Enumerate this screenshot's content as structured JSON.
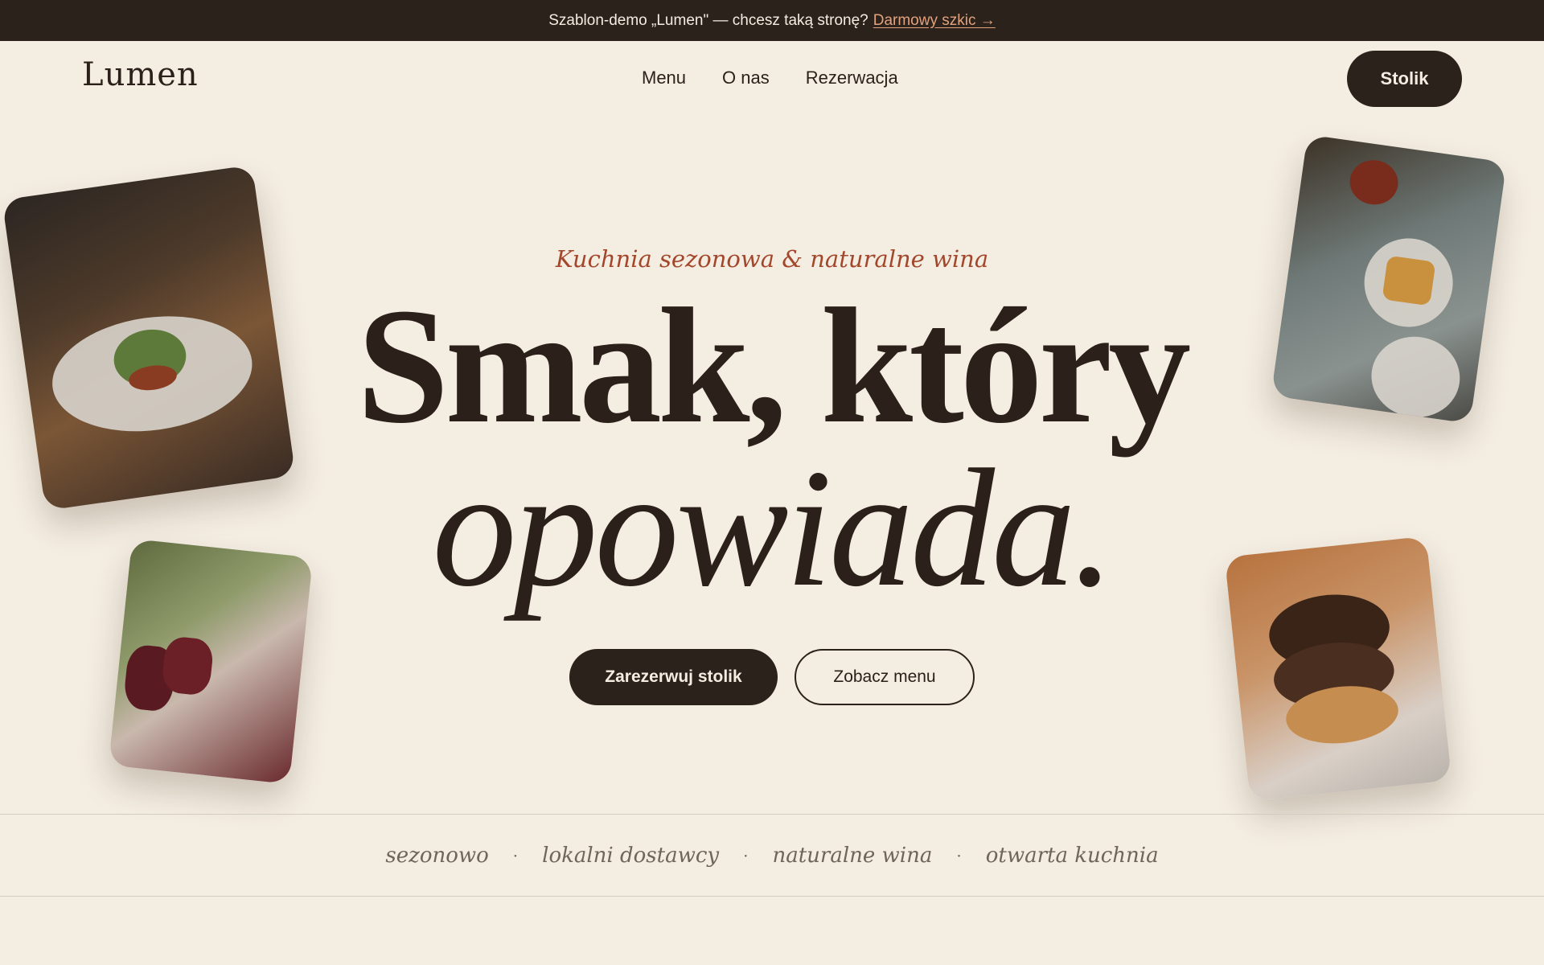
{
  "promo": {
    "text": "Szablon-demo „Lumen\" — chcesz taką stronę?",
    "link": "Darmowy szkic →"
  },
  "header": {
    "logo": "Lumen",
    "nav": [
      "Menu",
      "O nas",
      "Rezerwacja"
    ],
    "cta": "Stolik"
  },
  "hero": {
    "tagline": "Kuchnia sezonowa & naturalne wina",
    "headline_line1": "Smak, który",
    "headline_line2": "opowiada.",
    "primary_button": "Zarezerwuj stolik",
    "secondary_button": "Zobacz menu"
  },
  "features": [
    "sezonowo",
    "lokalni dostawcy",
    "naturalne wina",
    "otwarta kuchnia"
  ],
  "colors": {
    "background": "#f4ede2",
    "dark": "#2b221b",
    "accent": "#a3472c",
    "link": "#e3a27e"
  }
}
